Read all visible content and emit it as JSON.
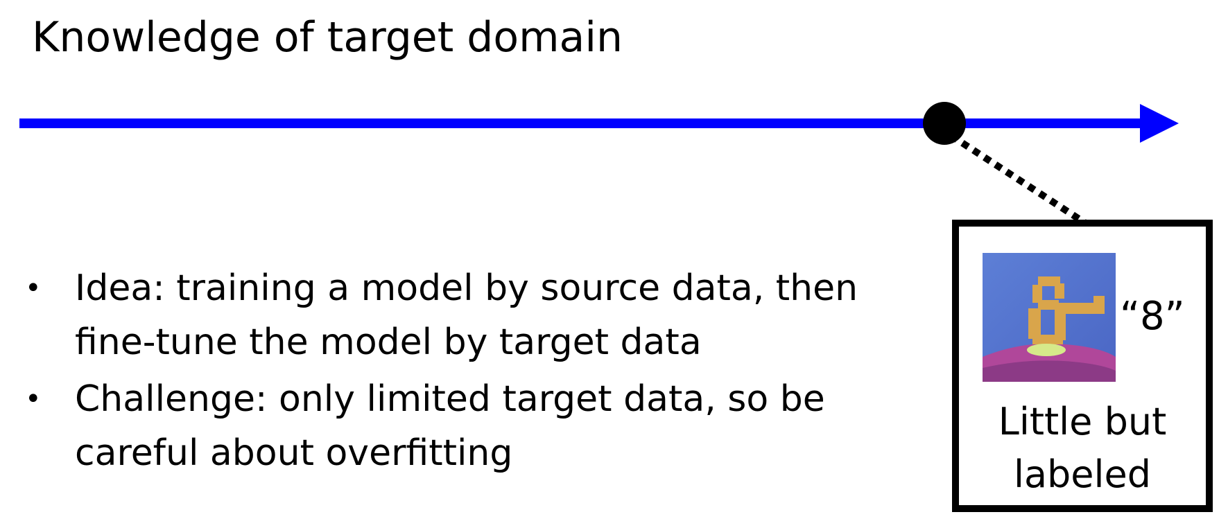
{
  "title": "Knowledge of target domain",
  "bullets": [
    {
      "text": "Idea: training a model by source data, then fine-tune the model by target data"
    },
    {
      "text": "Challenge: only limited target data, so be careful about overfitting"
    }
  ],
  "example": {
    "label": "“8”",
    "caption_line1": "Little but",
    "caption_line2": "labeled",
    "image": "digit-8-thumbnail"
  },
  "colors": {
    "axis": "#0000ff",
    "marker": "#000000",
    "connector": "#000000",
    "box_border": "#000000"
  }
}
